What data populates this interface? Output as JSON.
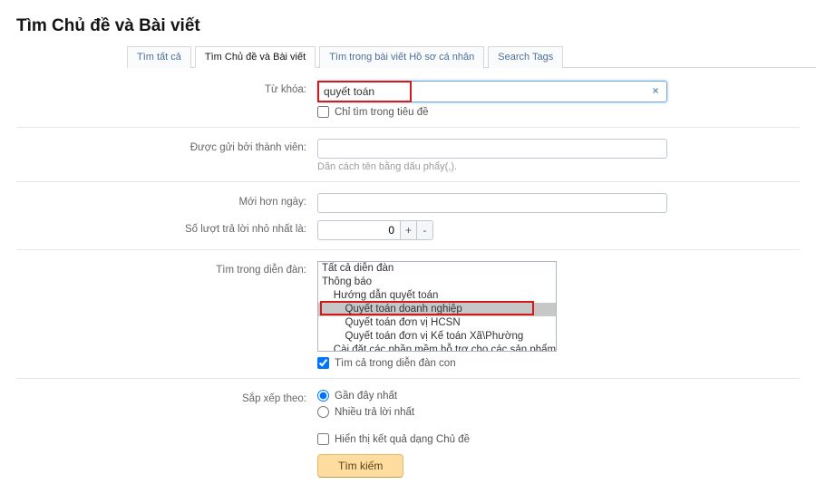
{
  "title": "Tìm Chủ đề và Bài viết",
  "tabs": [
    {
      "label": "Tìm tất cả"
    },
    {
      "label": "Tìm Chủ đề và Bài viết"
    },
    {
      "label": "Tìm trong bài viết Hồ sơ cá nhân"
    },
    {
      "label": "Search Tags"
    }
  ],
  "active_tab_index": 1,
  "keyword": {
    "label": "Từ khóa:",
    "value": "quyết toán",
    "clear_glyph": "×",
    "titles_only_label": "Chỉ tìm trong tiêu đề",
    "titles_only_checked": false
  },
  "member": {
    "label": "Được gửi bởi thành viên:",
    "value": "",
    "hint": "Dãn cách tên bằng dấu phẩy(,)."
  },
  "newer_than": {
    "label": "Mới hơn ngày:",
    "value": ""
  },
  "min_replies": {
    "label": "Số lượt trả lời nhỏ nhất là:",
    "value": "0",
    "plus": "+",
    "minus": "-"
  },
  "forums": {
    "label": "Tìm trong diễn đàn:",
    "options": [
      {
        "text": "Tất cả diễn đàn",
        "indent": 0,
        "selected": false
      },
      {
        "text": "Thông báo",
        "indent": 0,
        "selected": false
      },
      {
        "text": "Hướng dẫn quyết toán",
        "indent": 1,
        "selected": false
      },
      {
        "text": "Quyết toán doanh nghiệp",
        "indent": 2,
        "selected": true
      },
      {
        "text": "Quyết toán đơn vị HCSN",
        "indent": 2,
        "selected": false
      },
      {
        "text": "Quyết toán đơn vị Kế toán Xã\\Phường",
        "indent": 2,
        "selected": false
      },
      {
        "text": "Cài đặt các phần mềm hỗ trợ cho các sản phẩm",
        "indent": 1,
        "selected": false
      }
    ],
    "search_children_label": "Tìm cả trong diễn đàn con",
    "search_children_checked": true
  },
  "sort": {
    "label": "Sắp xếp theo:",
    "options": [
      {
        "label": "Gần đây nhất",
        "checked": true
      },
      {
        "label": "Nhiều trả lời nhất",
        "checked": false
      }
    ],
    "as_threads_label": "Hiển thị kết quả dạng Chủ đề",
    "as_threads_checked": false
  },
  "submit_label": "Tìm kiếm"
}
